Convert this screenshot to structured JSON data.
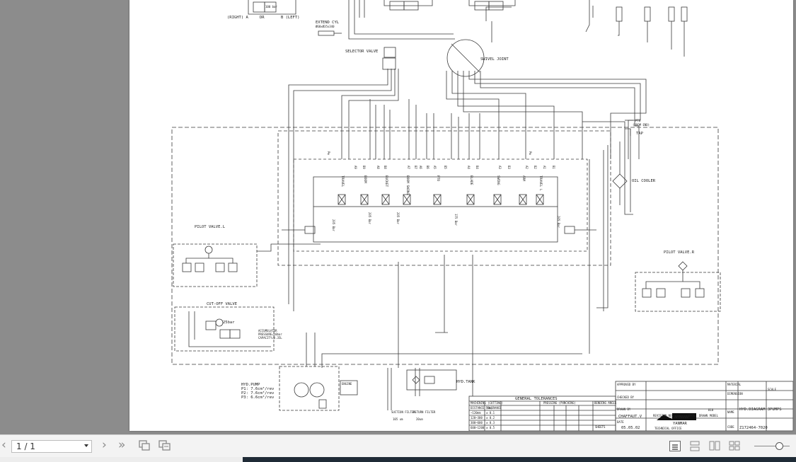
{
  "pager": {
    "current": "1 / 1"
  },
  "toolbar": {
    "icons": [
      "chevron-left-icon",
      "chevron-right-icon",
      "double-chevron-right-icon",
      "fit-page-icon",
      "fit-width-icon",
      "single-page-view-icon",
      "continuous-view-icon",
      "two-page-view-icon",
      "two-page-continuous-view-icon",
      "zoom-slider"
    ]
  },
  "drawing": {
    "labels": {
      "right_a": "(RIGHT) A",
      "b_left": "B (LEFT)",
      "dr": "DR",
      "bar100": "100 bar",
      "extend_cyl": "EXTEND CYL",
      "extend_cyl_dim": "Ø60xØ35x340",
      "selector_valve": "SELECTOR VALVE",
      "swivel_joint": "SWIVEL JOINT",
      "pto_boom_end": "PTO",
      "boom_end": "(BOOM END)",
      "tap": "TAP",
      "oil_cooler": "OIL COOLER",
      "pilot_valve_l": "PILOT VALVE.L",
      "pilot_valve_r": "PILOT VALVE.R",
      "cut_off_valve": "CUT-OFF VALVE",
      "bar25": "25bar",
      "accumulator": "ACCUMULATOR",
      "accumulator_p": "PRESSURE=10bar",
      "accumulator_c": "CAPACITY=0.35L",
      "hyd_pump": "HYD.PUMP",
      "p1": "P1: 7.6cm³/rev",
      "p2": "P2: 7.6cm³/rev",
      "p3": "P3: 6.6cm³/rev",
      "engine": "ENGINE",
      "hyd_tank": "HYD.TANK",
      "suction_filter": "SUCTION FILTER",
      "suction_filter_val": "105 um",
      "return_filter": "RETURN FILTER",
      "return_filter_val": "20um",
      "travel_r": "TRAVEL",
      "boom": "BOOM",
      "bucket": "BUCKET",
      "boom_swing": "BOOM SWING",
      "pto": "PTO",
      "blade": "BLADE",
      "swing": "SWING",
      "arm": "ARM",
      "travel_l": "TRAVEL L",
      "bar205a": "205 Bar",
      "bar205b": "205 Bar",
      "bar205c": "205 Bar",
      "bar175": "175 Bar",
      "bar205d": "205 Bar",
      "ports": [
        "A1",
        "B1",
        "A2",
        "B2",
        "A3",
        "B3",
        "A4",
        "B4",
        "A5",
        "B5",
        "A6",
        "B6",
        "A7",
        "B7",
        "A8",
        "B8",
        "A9",
        "B9"
      ],
      "pw": "Pw"
    },
    "tolerances": {
      "title": "GENERAL TOLERANCES",
      "machining": "MACHINING (CUTTING)",
      "pressing": "PRESSING (PUNCHING)",
      "bending": "BENDING ANGLE",
      "rows": [
        [
          "DISTANCE (mm)",
          "TOLERANCE"
        ],
        [
          "~120mm",
          "± 0.1"
        ],
        [
          "120~300",
          "± 0.2"
        ],
        [
          "300~600",
          "± 0.3"
        ],
        [
          "600~1200",
          "± 0.5"
        ],
        [
          "1200~3000",
          "± 0.8"
        ]
      ]
    },
    "titleblock": {
      "approved_by": "APPROVED BY",
      "checked_by": "CHECKED BY",
      "drawn_by": "DRAWN BY",
      "drawn_by_name": "CHAFFAUT.V",
      "date_label": "DATE",
      "date": "05.05.02",
      "revision_no": "REVISION NO.",
      "date_col": "DATE",
      "drawn_col": "DRAWN",
      "model": "MODEL",
      "model_val": "B18",
      "material": "MATERIAL",
      "dimension": "DIMENSION",
      "scale": "SCALE",
      "name": "NAME",
      "name_val": "HYD.DIAGRAM 3PUMPS",
      "code": "CODE",
      "code_val": "Z172464-7020",
      "brand1": "AMMANN",
      "brand2": "YANMAR",
      "brand_sub": "TECHNICAL OFFICE",
      "sheets": "SHEETS"
    }
  }
}
